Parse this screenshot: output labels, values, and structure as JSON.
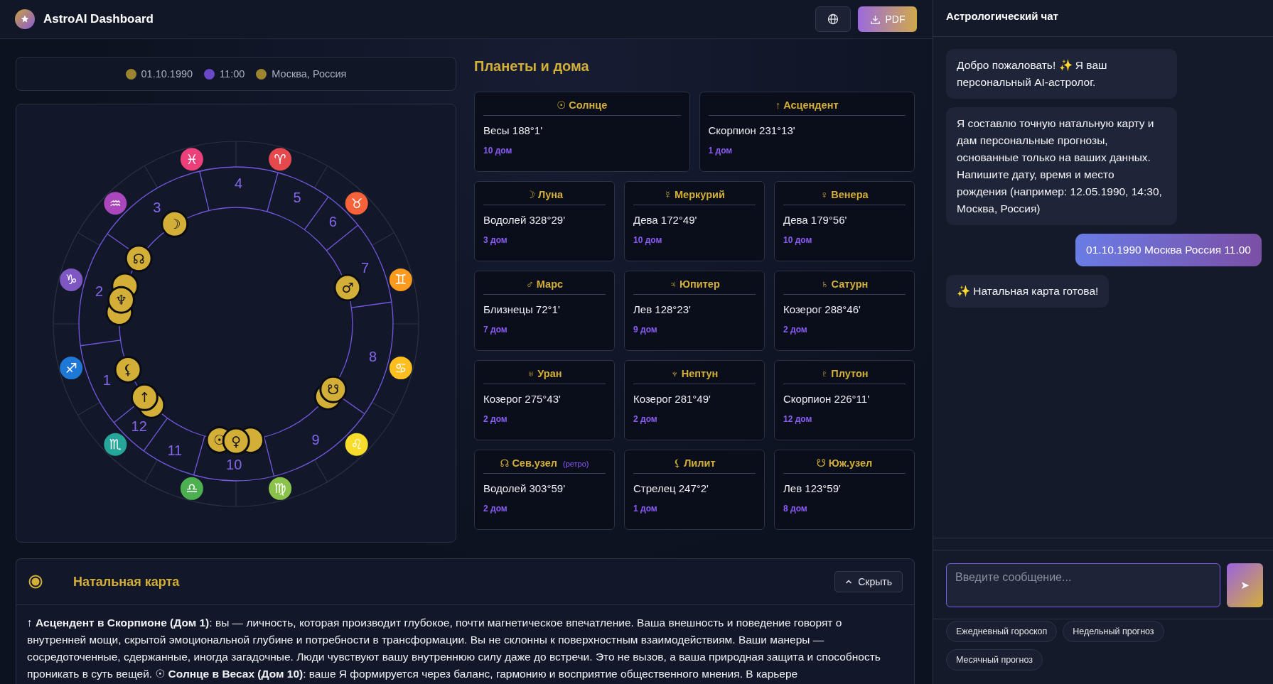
{
  "header": {
    "title": "AstroAI Dashboard",
    "pdf_button": "PDF"
  },
  "birth_info": [
    {
      "text": "01.10.1990",
      "color": "#9c8530"
    },
    {
      "text": "11:00",
      "color": "#6a48c8"
    },
    {
      "text": "Москва, Россия",
      "color": "#9c8530"
    }
  ],
  "wheel": {
    "zodiac": [
      {
        "glyph": "♈",
        "color": "#e5484d"
      },
      {
        "glyph": "♉",
        "color": "#f8623a"
      },
      {
        "glyph": "♊",
        "color": "#fb9a1e"
      },
      {
        "glyph": "♋",
        "color": "#fdbf1f"
      },
      {
        "glyph": "♌",
        "color": "#f7dc2c"
      },
      {
        "glyph": "♍",
        "color": "#8bc34a"
      },
      {
        "glyph": "♎",
        "color": "#4caf50"
      },
      {
        "glyph": "♏",
        "color": "#26a69a"
      },
      {
        "glyph": "♐",
        "color": "#1e78d6"
      },
      {
        "glyph": "♑",
        "color": "#7e57c2"
      },
      {
        "glyph": "♒",
        "color": "#ab47bc"
      },
      {
        "glyph": "♓",
        "color": "#ec407a"
      }
    ],
    "houses": [
      "1",
      "2",
      "3",
      "4",
      "5",
      "6",
      "7",
      "8",
      "9",
      "10",
      "11",
      "12"
    ],
    "planets": [
      {
        "kind": "glyph",
        "glyph": "☉"
      },
      {
        "kind": "glyph",
        "glyph": "↑"
      },
      {
        "kind": "glyph",
        "glyph": "☽"
      },
      {
        "kind": "covered"
      },
      {
        "kind": "glyph",
        "glyph": "♀"
      },
      {
        "kind": "glyph",
        "glyph": "♂"
      },
      {
        "kind": "covered"
      },
      {
        "kind": "covered"
      },
      {
        "kind": "covered"
      },
      {
        "kind": "glyph",
        "glyph": "♆"
      },
      {
        "kind": "covered"
      },
      {
        "kind": "glyph",
        "glyph": "☊"
      },
      {
        "kind": "glyph",
        "glyph": "⚸"
      },
      {
        "kind": "glyph",
        "glyph": "☋"
      }
    ]
  },
  "planets_section": {
    "title": "Планеты и дома",
    "cards": [
      {
        "title": "☉ Солнце",
        "position": "Весы 188°1'",
        "house": "10 дом"
      },
      {
        "title": "↑ Асцендент",
        "position": "Скорпион 231°13'",
        "house": "1 дом"
      },
      {
        "title": "☽ Луна",
        "position": "Водолей 328°29'",
        "house": "3 дом"
      },
      {
        "title": "☿ Меркурий",
        "position": "Дева 172°49'",
        "house": "10 дом"
      },
      {
        "title": "♀ Венера",
        "position": "Дева 179°56'",
        "house": "10 дом"
      },
      {
        "title": "♂ Марс",
        "position": "Близнецы 72°1'",
        "house": "7 дом"
      },
      {
        "title": "♃ Юпитер",
        "position": "Лев 128°23'",
        "house": "9 дом"
      },
      {
        "title": "♄ Сатурн",
        "position": "Козерог 288°46'",
        "house": "2 дом"
      },
      {
        "title": "♅ Уран",
        "position": "Козерог 275°43'",
        "house": "2 дом"
      },
      {
        "title": "♆ Нептун",
        "position": "Козерог 281°49'",
        "house": "2 дом"
      },
      {
        "title": "♇ Плутон",
        "position": "Скорпион 226°11'",
        "house": "12 дом"
      },
      {
        "title": "☊ Сев.узел",
        "tag": "(ретро)",
        "position": "Водолей 303°59'",
        "house": "2 дом"
      },
      {
        "title": "⚸ Лилит",
        "position": "Стрелец 247°2'",
        "house": "1 дом"
      },
      {
        "title": "☋ Юж.узел",
        "position": "Лев 123°59'",
        "house": "8 дом"
      }
    ]
  },
  "natal": {
    "title": "Натальная карта",
    "hide_button": "Скрыть",
    "text": "↑ **Асцендент в Скорпионе (Дом 1)**: вы — личность, которая производит глубокое, почти магнетическое впечатление. Ваша внешность и поведение говорят о внутренней мощи, скрытой эмоциональной глубине и потребности в трансформации. Вы не склонны к поверхностным взаимодействиям. Ваши манеры — сосредоточенные, сдержанные, иногда загадочные. Люди чувствуют вашу внутреннюю силу даже до встречи. Это не вызов, а ваша природная защита и способность проникать в суть вещей. ☉ **Солнце в Весах (Дом 10)**: ваше Я формируется через баланс, гармонию и восприятие общественного мнения. В карьере"
  },
  "chat": {
    "title": "Астрологический чат",
    "messages": [
      {
        "kind": "bot",
        "text": "Добро пожаловать! ✨ Я ваш персональный AI-астролог."
      },
      {
        "kind": "bot",
        "text": "Я составлю точную натальную карту и дам персональные прогнозы, основанные только на ваших данных. Напишите дату, время и место рождения (например: 12.05.1990, 14:30, Москва, Россия)"
      },
      {
        "kind": "user",
        "text": "01.10.1990 Москва Россия 11.00"
      },
      {
        "kind": "bot",
        "text": "✨ Натальная карта готова!"
      }
    ],
    "input": {
      "placeholder": "Введите сообщение..."
    },
    "send_button": "➤",
    "quick_actions": [
      "Ежедневный гороскоп",
      "Недельный прогноз",
      "Месячный прогноз"
    ]
  }
}
